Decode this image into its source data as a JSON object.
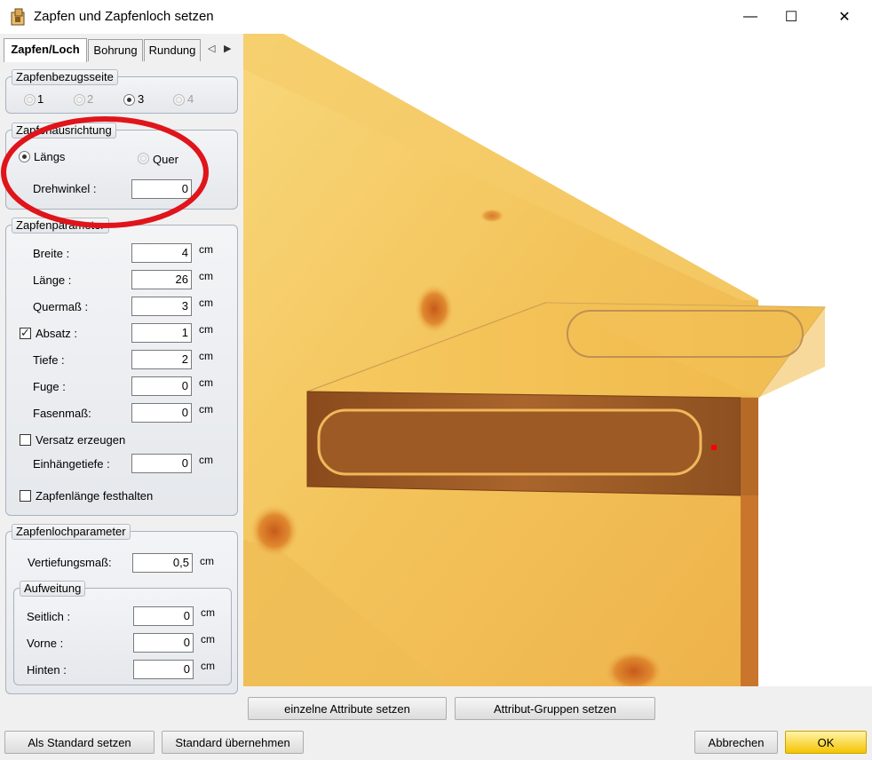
{
  "window": {
    "title": "Zapfen und Zapfenloch setzen",
    "minimize_glyph": "—",
    "maximize_glyph": "☐",
    "close_glyph": "✕"
  },
  "tabs": {
    "items": [
      "Zapfen/Loch",
      "Bohrung",
      "Rundung"
    ],
    "active": "Zapfen/Loch",
    "left_arrow": "◁",
    "right_arrow": "▶"
  },
  "bezugsseite": {
    "legend": "Zapfenbezugsseite",
    "options": [
      "1",
      "2",
      "3",
      "4"
    ],
    "selected": "3"
  },
  "ausrichtung": {
    "legend": "Zapfenausrichtung",
    "laengs": "Längs",
    "quer": "Quer",
    "selected": "Längs",
    "drehwinkel_label": "Drehwinkel :",
    "drehwinkel_value": "0"
  },
  "zapfenparameter": {
    "legend": "Zapfenparameter",
    "rows": [
      {
        "label": "Breite :",
        "value": "4",
        "unit": "cm"
      },
      {
        "label": "Länge :",
        "value": "26",
        "unit": "cm"
      },
      {
        "label": "Quermaß :",
        "value": "3",
        "unit": "cm"
      },
      {
        "label": "Absatz :",
        "value": "1",
        "unit": "cm"
      },
      {
        "label": "Tiefe :",
        "value": "2",
        "unit": "cm"
      },
      {
        "label": "Fuge :",
        "value": "0",
        "unit": "cm"
      },
      {
        "label": "Fasenmaß:",
        "value": "0",
        "unit": "cm"
      }
    ],
    "absatz_checked": true,
    "versatz_label": "Versatz erzeugen",
    "versatz_checked": false,
    "einhaenge_label": "Einhängetiefe :",
    "einhaenge_value": "0",
    "einhaenge_unit": "cm",
    "festhalten_label": "Zapfenlänge festhalten",
    "festhalten_checked": false
  },
  "zapfenlochparameter": {
    "legend": "Zapfenlochparameter",
    "vertiefung_label": "Vertiefungsmaß:",
    "vertiefung_value": "0,5",
    "vertiefung_unit": "cm",
    "aufweitung": {
      "legend": "Aufweitung",
      "rows": [
        {
          "label": "Seitlich :",
          "value": "0",
          "unit": "cm"
        },
        {
          "label": "Vorne :",
          "value": "0",
          "unit": "cm"
        },
        {
          "label": "Hinten :",
          "value": "0",
          "unit": "cm"
        }
      ]
    }
  },
  "buttons": {
    "einzelne": "einzelne Attribute setzen",
    "gruppen": "Attribut-Gruppen setzen",
    "als_standard": "Als Standard setzen",
    "standard_uebernehmen": "Standard übernehmen",
    "abbrechen": "Abbrechen",
    "ok": "OK"
  },
  "colors": {
    "wood_light": "#f6cf62",
    "wood_mid": "#e8a93a",
    "wood_dark": "#9a4f1a",
    "annotation_red": "#e0141b",
    "ok_button": "#f5c400"
  }
}
